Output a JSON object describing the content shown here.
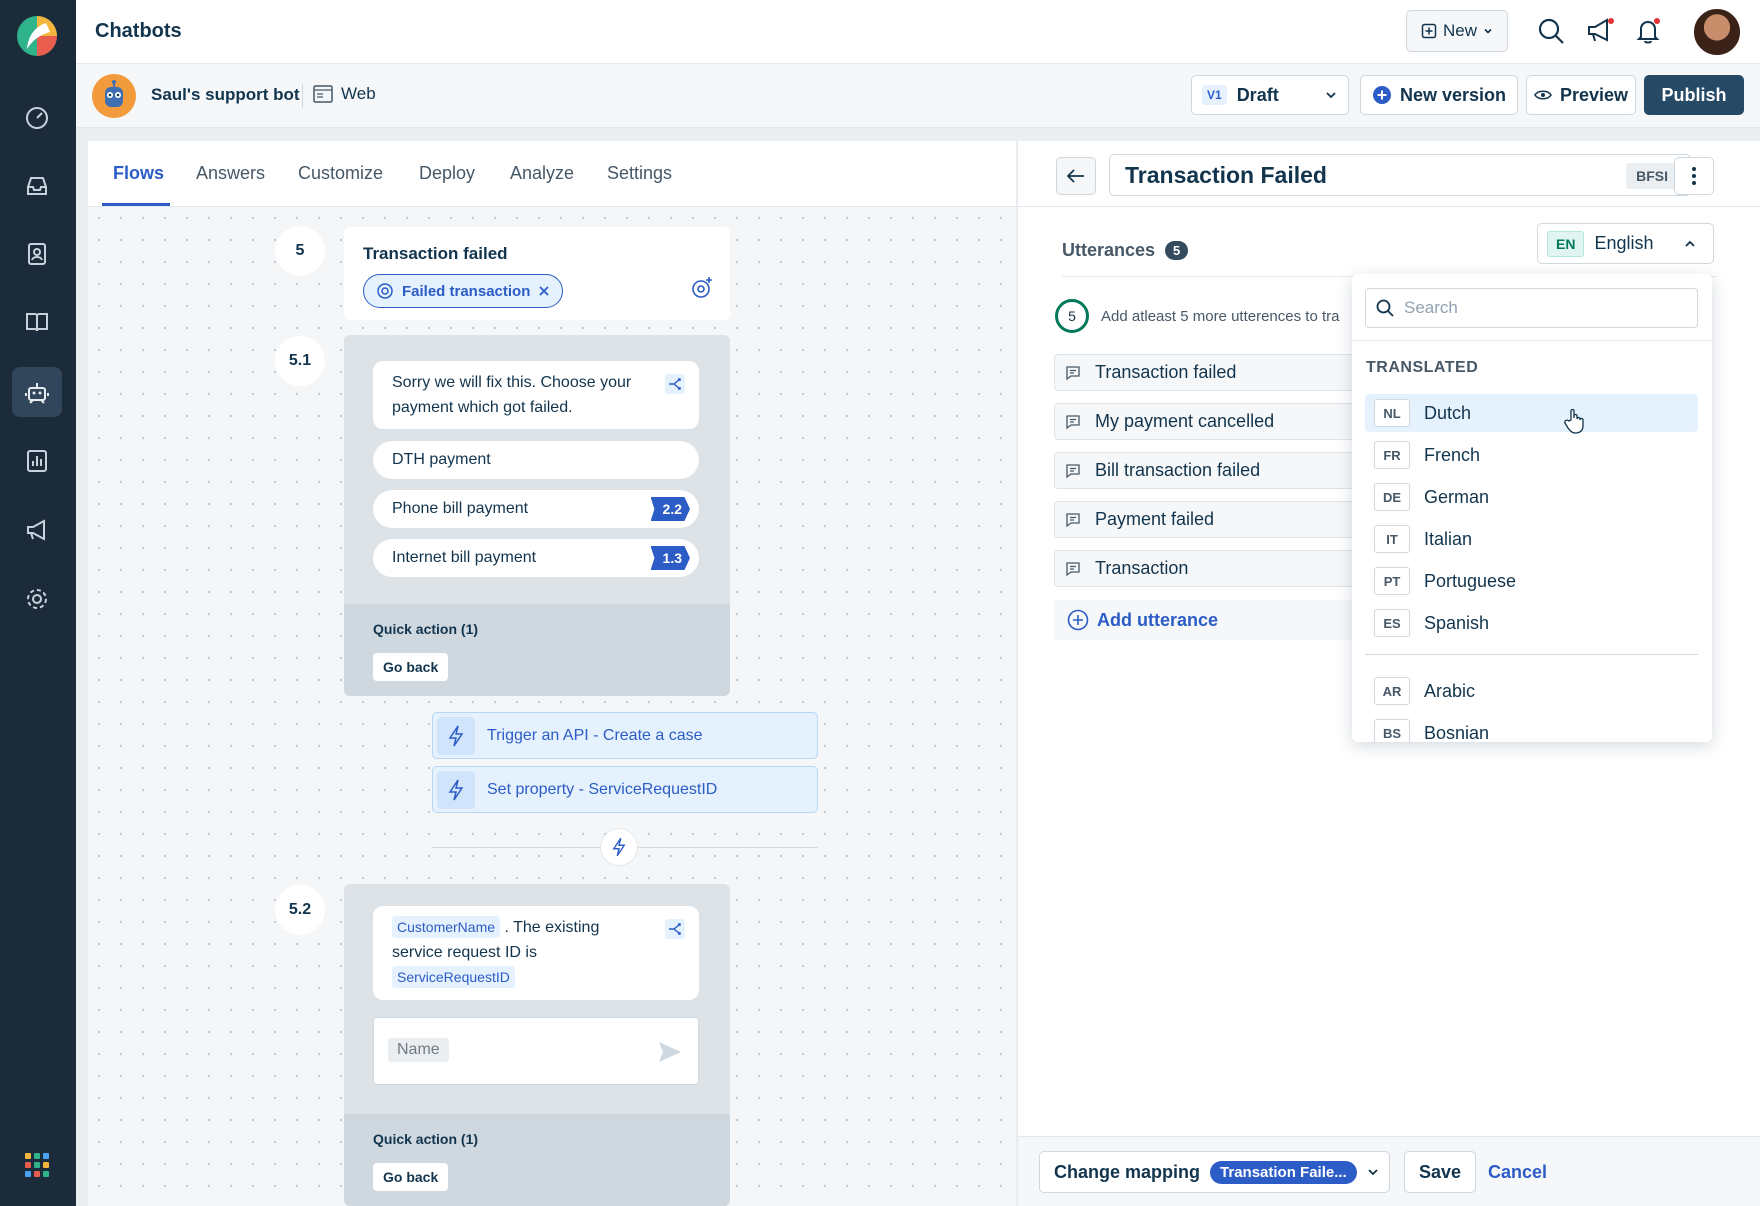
{
  "app": {
    "title": "Chatbots"
  },
  "topbar": {
    "new_label": "New"
  },
  "bot": {
    "name": "Saul's support bot",
    "channel": "Web"
  },
  "version": {
    "tag": "V1",
    "status": "Draft"
  },
  "actions": {
    "new_version": "New version",
    "preview": "Preview",
    "publish": "Publish"
  },
  "tabs": [
    "Flows",
    "Answers",
    "Customize",
    "Deploy",
    "Analyze",
    "Settings"
  ],
  "flow": {
    "step5": {
      "number": "5",
      "title": "Transaction failed",
      "intent": "Failed transaction"
    },
    "step51": {
      "number": "5.1",
      "message": "Sorry we will fix this. Choose your payment which got failed.",
      "options": [
        {
          "label": "DTH payment",
          "jump": ""
        },
        {
          "label": "Phone bill payment",
          "jump": "2.2"
        },
        {
          "label": "Internet bill payment",
          "jump": "1.3"
        }
      ],
      "quick_action_label": "Quick action (1)",
      "quick_action_button": "Go back"
    },
    "actions": [
      "Trigger an API - Create a case",
      "Set property - ServiceRequestID"
    ],
    "step52": {
      "number": "5.2",
      "var1": "CustomerName",
      "text": ". The existing service request ID is",
      "var2": "ServiceRequestID",
      "input_placeholder": "Name",
      "quick_action_label": "Quick action (1)",
      "quick_action_button": "Go back"
    }
  },
  "detail": {
    "title": "Transaction Failed",
    "category": "BFSI",
    "utterances_label": "Utterances",
    "utterances_count": "5",
    "language_code": "EN",
    "language": "English",
    "hint_count": "5",
    "hint_text": "Add atleast 5 more utterences to tra",
    "utterances": [
      "Transaction failed",
      "My payment cancelled",
      "Bill transaction failed",
      "Payment failed",
      "Transaction"
    ],
    "add_utterance": "Add utterance",
    "change_mapping": "Change mapping",
    "mapping_value": "Transation Faile...",
    "save": "Save",
    "cancel": "Cancel"
  },
  "language_dropdown": {
    "search_placeholder": "Search",
    "section": "TRANSLATED",
    "translated": [
      {
        "code": "NL",
        "name": "Dutch"
      },
      {
        "code": "FR",
        "name": "French"
      },
      {
        "code": "DE",
        "name": "German"
      },
      {
        "code": "IT",
        "name": "Italian"
      },
      {
        "code": "PT",
        "name": "Portuguese"
      },
      {
        "code": "ES",
        "name": "Spanish"
      }
    ],
    "others": [
      {
        "code": "AR",
        "name": "Arabic"
      },
      {
        "code": "BS",
        "name": "Bosnian"
      }
    ]
  },
  "colors": {
    "primary": "#2c5cc5",
    "sidebar": "#1c2b3a",
    "publish": "#264966",
    "success": "#00795b"
  }
}
